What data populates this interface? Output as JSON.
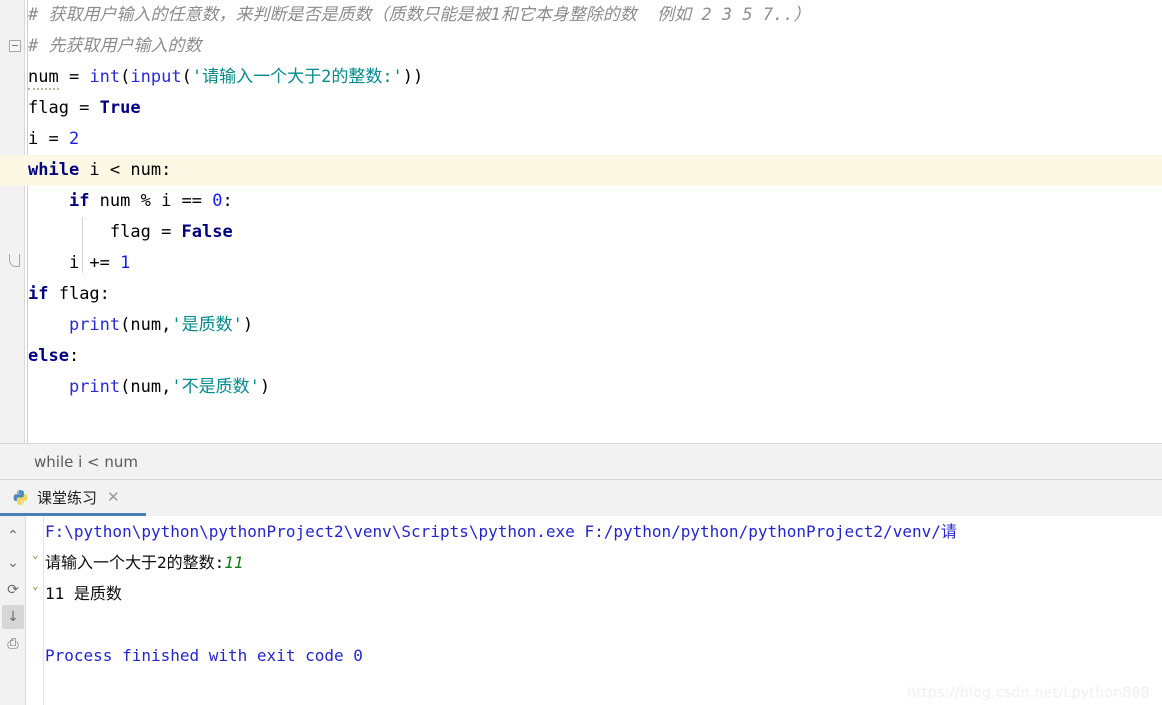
{
  "editor": {
    "lines": [
      {
        "id": "line-1",
        "indent": 0,
        "tokens": [
          {
            "cls": "tok-comment",
            "text": "# 获取用户输入的任意数，来判断是否是质数（质数只能是被1和它本身整除的数  例如 2 3 5 7..）"
          }
        ],
        "highlight": false,
        "fold": "none"
      },
      {
        "id": "line-2",
        "indent": 0,
        "tokens": [
          {
            "cls": "tok-comment",
            "text": "# 先获取用户输入的数"
          }
        ],
        "highlight": false,
        "fold": "box"
      },
      {
        "id": "line-3",
        "indent": 0,
        "tokens": [
          {
            "cls": "tok-warn",
            "text": "num"
          },
          {
            "cls": "tok-plain",
            "text": " = "
          },
          {
            "cls": "tok-fn",
            "text": "int"
          },
          {
            "cls": "tok-plain",
            "text": "("
          },
          {
            "cls": "tok-fn",
            "text": "input"
          },
          {
            "cls": "tok-plain",
            "text": "("
          },
          {
            "cls": "tok-str",
            "text": "'请输入一个大于2的整数:'"
          },
          {
            "cls": "tok-plain",
            "text": "))"
          }
        ],
        "highlight": false,
        "fold": "none"
      },
      {
        "id": "line-4",
        "indent": 0,
        "tokens": [
          {
            "cls": "tok-plain",
            "text": "flag = "
          },
          {
            "cls": "tok-kw",
            "text": "True"
          }
        ],
        "highlight": false,
        "fold": "none"
      },
      {
        "id": "line-5",
        "indent": 0,
        "tokens": [
          {
            "cls": "tok-plain",
            "text": "i = "
          },
          {
            "cls": "tok-num",
            "text": "2"
          }
        ],
        "highlight": false,
        "fold": "none"
      },
      {
        "id": "line-6",
        "indent": 0,
        "tokens": [
          {
            "cls": "tok-kw",
            "text": "while"
          },
          {
            "cls": "tok-plain",
            "text": " i < num:"
          }
        ],
        "highlight": true,
        "fold": "shield"
      },
      {
        "id": "line-7",
        "indent": 1,
        "tokens": [
          {
            "cls": "tok-kw",
            "text": "if"
          },
          {
            "cls": "tok-plain",
            "text": " num % i == "
          },
          {
            "cls": "tok-num",
            "text": "0"
          },
          {
            "cls": "tok-plain",
            "text": ":"
          }
        ],
        "highlight": false,
        "fold": "none"
      },
      {
        "id": "line-8",
        "indent": 2,
        "tokens": [
          {
            "cls": "tok-plain",
            "text": "flag = "
          },
          {
            "cls": "tok-kw",
            "text": "False"
          }
        ],
        "highlight": false,
        "fold": "none"
      },
      {
        "id": "line-9",
        "indent": 1,
        "tokens": [
          {
            "cls": "tok-plain",
            "text": "i += "
          },
          {
            "cls": "tok-num",
            "text": "1"
          }
        ],
        "highlight": false,
        "fold": "arc"
      },
      {
        "id": "line-10",
        "indent": 0,
        "tokens": [
          {
            "cls": "tok-kw",
            "text": "if"
          },
          {
            "cls": "tok-plain",
            "text": " flag:"
          }
        ],
        "highlight": false,
        "fold": "none"
      },
      {
        "id": "line-11",
        "indent": 1,
        "tokens": [
          {
            "cls": "tok-fn",
            "text": "print"
          },
          {
            "cls": "tok-plain",
            "text": "(num,"
          },
          {
            "cls": "tok-str",
            "text": "'是质数'"
          },
          {
            "cls": "tok-plain",
            "text": ")"
          }
        ],
        "highlight": false,
        "fold": "none"
      },
      {
        "id": "line-12",
        "indent": 0,
        "tokens": [
          {
            "cls": "tok-kw",
            "text": "else"
          },
          {
            "cls": "tok-plain",
            "text": ":"
          }
        ],
        "highlight": false,
        "fold": "none"
      },
      {
        "id": "line-13",
        "indent": 1,
        "tokens": [
          {
            "cls": "tok-fn",
            "text": "print"
          },
          {
            "cls": "tok-plain",
            "text": "(num,"
          },
          {
            "cls": "tok-str",
            "text": "'不是质数'"
          },
          {
            "cls": "tok-plain",
            "text": ")"
          }
        ],
        "highlight": false,
        "fold": "none"
      }
    ]
  },
  "breadcrumb": {
    "text": "while i < num"
  },
  "run_panel": {
    "tab": {
      "label": "课堂练习",
      "icon": "python-logo-icon",
      "close_label": "✕"
    },
    "toolbar": [
      {
        "name": "scroll-up-icon",
        "glyph": "⌃",
        "active": false
      },
      {
        "name": "scroll-down-icon",
        "glyph": "⌄",
        "active": false
      },
      {
        "name": "rerun-icon",
        "glyph": "⟳",
        "active": false
      },
      {
        "name": "scroll-to-end-icon",
        "glyph": "↓",
        "active": true
      },
      {
        "name": "print-icon",
        "glyph": "⎙",
        "active": false
      }
    ],
    "console": [
      {
        "id": "console-line-1",
        "parts": [
          {
            "cls": "con-path",
            "text": "F:\\python\\python\\pythonProject2\\venv\\Scripts\\python.exe F:/python/python/pythonProject2/venv/请"
          }
        ]
      },
      {
        "id": "console-line-2",
        "parts": [
          {
            "cls": "con-black",
            "text": "请输入一个大于2的整数:"
          },
          {
            "cls": "con-input",
            "text": "11"
          }
        ]
      },
      {
        "id": "console-line-3",
        "parts": [
          {
            "cls": "con-black",
            "text": "11 是质数"
          }
        ]
      },
      {
        "id": "console-line-4",
        "parts": [
          {
            "cls": "con-path",
            "text": ""
          }
        ]
      },
      {
        "id": "console-line-5",
        "parts": [
          {
            "cls": "con-path",
            "text": "Process finished with exit code 0"
          }
        ]
      }
    ]
  },
  "watermark": {
    "text": "https://blog.csdn.net/Lpython888"
  },
  "colors": {
    "keyword": "#000080",
    "function": "#2b2bd4",
    "string": "#058b8b",
    "number": "#1a1aee",
    "comment": "#8c8c8c",
    "console_text": "#2525cc",
    "console_input": "#1a7a1a",
    "line_highlight": "#fdf8e4",
    "tab_accent": "#4a7ebb",
    "gutter_bg": "#f2f2f2"
  }
}
